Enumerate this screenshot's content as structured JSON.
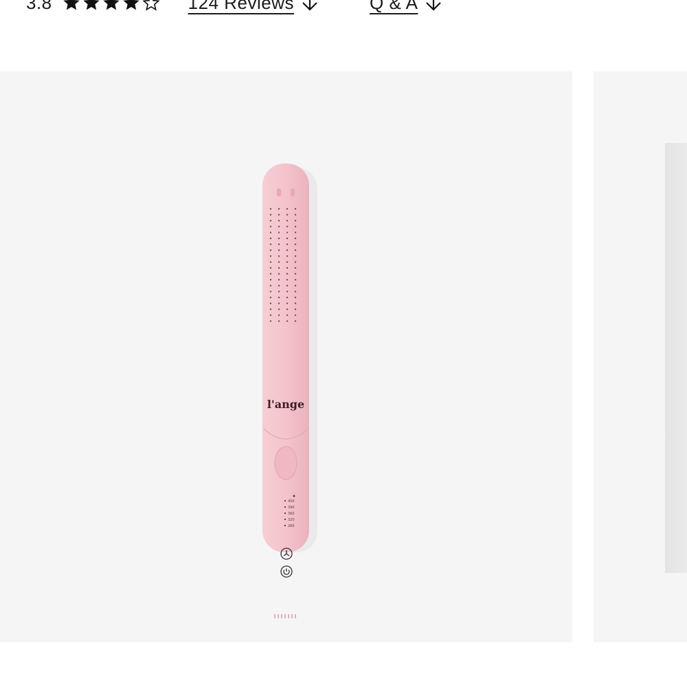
{
  "rating": {
    "value": "3.8",
    "stars_filled": 4,
    "stars_total": 5
  },
  "links": {
    "reviews_label": "124 Reviews",
    "qa_label": "Q & A"
  },
  "product": {
    "brand_logo": "l'ange",
    "temperature_settings": [
      "450",
      "390",
      "360",
      "320",
      "280"
    ],
    "body_color": "#f5c8cf"
  },
  "icons": {
    "star_filled": "star-filled-icon",
    "star_empty": "star-outline-icon",
    "arrow_down": "arrow-down-icon",
    "fan": "fan-icon",
    "power": "power-icon"
  }
}
